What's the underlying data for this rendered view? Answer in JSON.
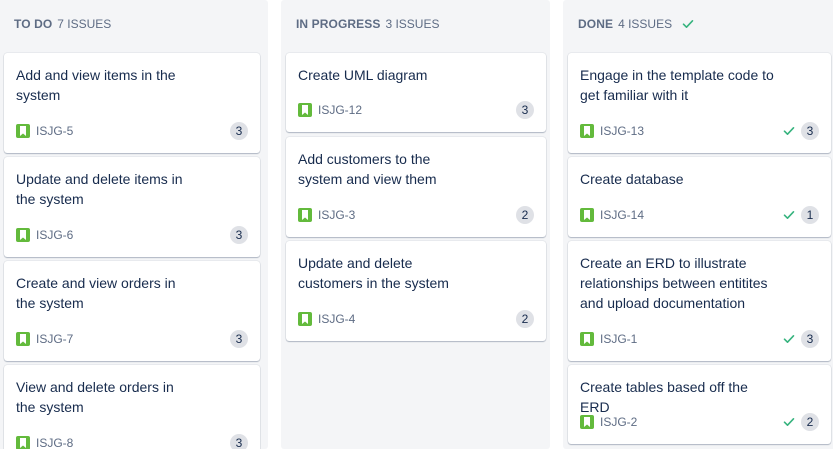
{
  "columns": [
    {
      "name": "TO DO",
      "count": "7 ISSUES",
      "cards": [
        {
          "title": "Add and view items in the system",
          "key": "ISJG-5",
          "points": "3",
          "done": false
        },
        {
          "title": "Update and delete items in the system",
          "key": "ISJG-6",
          "points": "3",
          "done": false
        },
        {
          "title": "Create and view orders in the system",
          "key": "ISJG-7",
          "points": "3",
          "done": false
        },
        {
          "title": "View and delete orders in the system",
          "key": "ISJG-8",
          "points": "3",
          "done": false
        }
      ]
    },
    {
      "name": "IN PROGRESS",
      "count": "3 ISSUES",
      "cards": [
        {
          "title": "Create UML diagram",
          "key": "ISJG-12",
          "points": "3",
          "done": false
        },
        {
          "title": "Add customers to the system and view them",
          "key": "ISJG-3",
          "points": "2",
          "done": false
        },
        {
          "title": "Update and delete customers in the system",
          "key": "ISJG-4",
          "points": "2",
          "done": false
        }
      ]
    },
    {
      "name": "DONE",
      "count": "4 ISSUES",
      "cards": [
        {
          "title": "Engage in the template code to get familiar with it",
          "key": "ISJG-13",
          "points": "3",
          "done": true
        },
        {
          "title": "Create database",
          "key": "ISJG-14",
          "points": "1",
          "done": true
        },
        {
          "title": "Create an ERD to illustrate relationships between entitites and upload documentation",
          "key": "ISJG-1",
          "points": "3",
          "done": true
        },
        {
          "title": "Create tables based off the ERD",
          "key": "ISJG-2",
          "points": "2",
          "done": true
        }
      ]
    }
  ],
  "icons": {
    "issue_type": "story-bookmark-icon",
    "resolved": "checkmark-icon"
  },
  "colors": {
    "story": "#63ba3c",
    "done_check": "#36b37e",
    "column_bg": "#f4f5f7"
  }
}
